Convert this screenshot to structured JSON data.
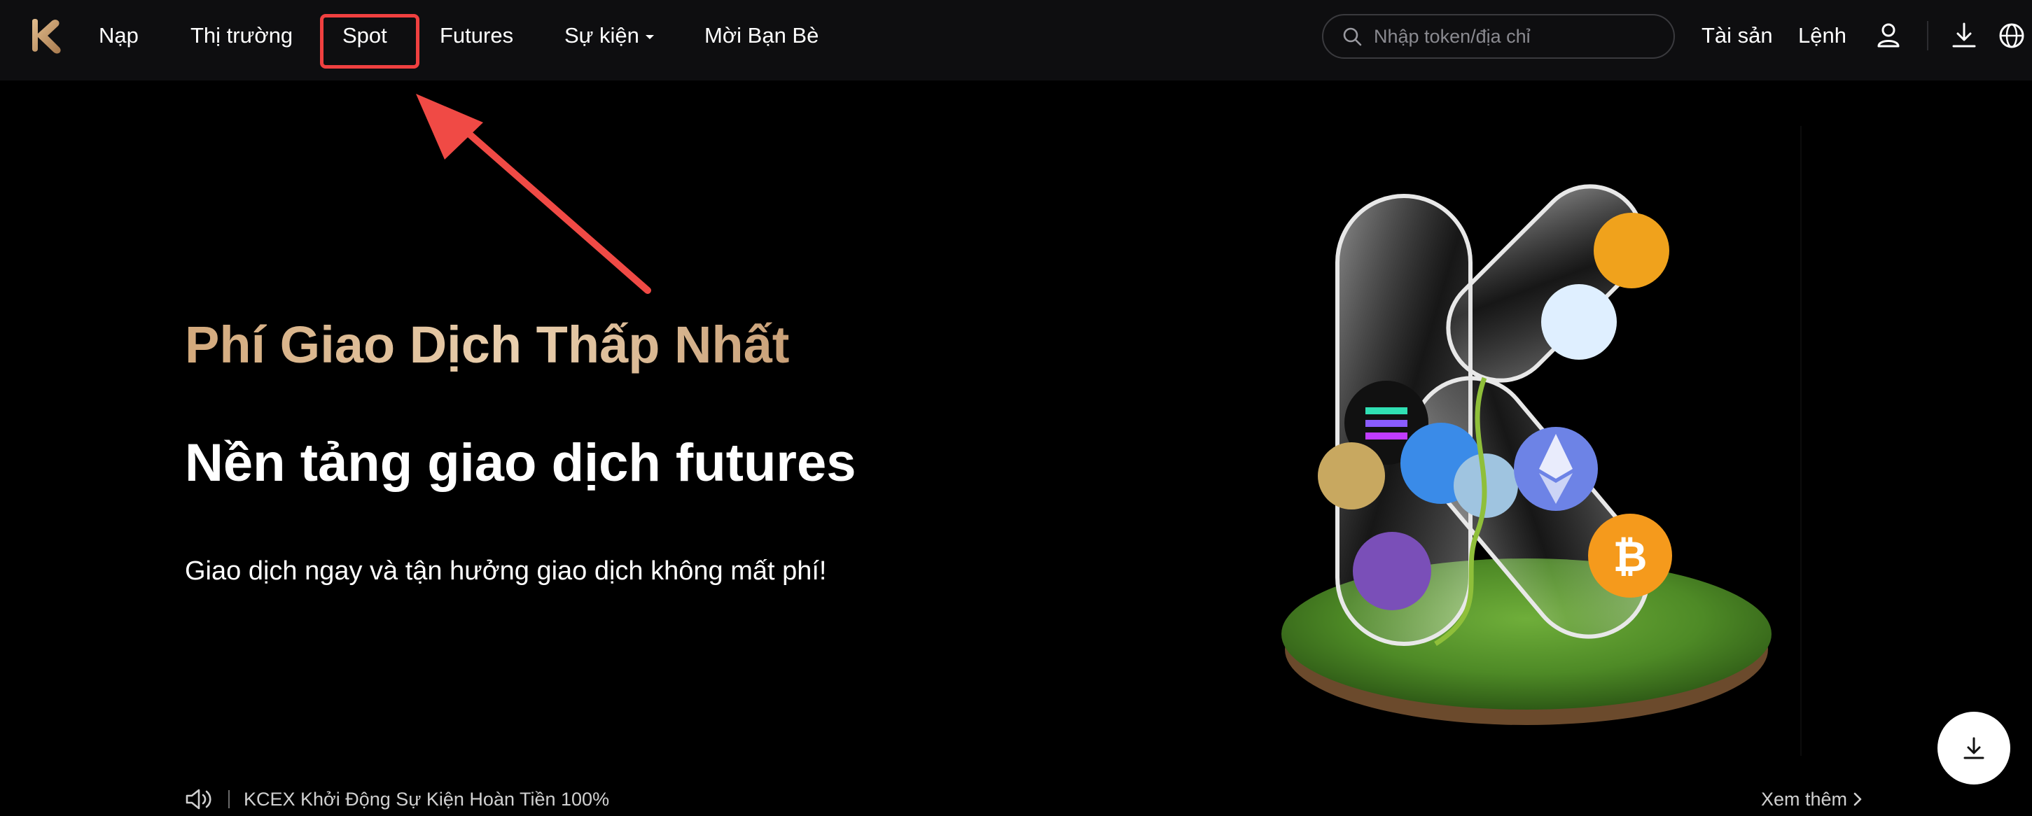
{
  "nav": {
    "items": [
      {
        "label": "Nạp"
      },
      {
        "label": "Thị trường"
      },
      {
        "label": "Spot"
      },
      {
        "label": "Futures"
      },
      {
        "label": "Sự kiện"
      },
      {
        "label": "Mời Bạn Bè"
      }
    ],
    "search_placeholder": "Nhập token/địa chỉ",
    "assets_label": "Tài sản",
    "orders_label": "Lệnh"
  },
  "hero": {
    "subtitle": "Phí Giao Dịch Thấp Nhất",
    "title": "Nền tảng giao dịch futures",
    "description": "Giao dịch ngay và tận hưởng giao dịch không mất phí!"
  },
  "announcement": {
    "text": "KCEX Khởi Động Sự Kiện Hoàn Tiền 100%",
    "see_more": "Xem thêm"
  },
  "icons": {
    "logo": "kcex-logo-icon",
    "search": "search-icon",
    "user": "user-icon",
    "download": "download-icon",
    "language": "globe-icon",
    "speaker": "speaker-icon",
    "chevron": "chevron-right-icon"
  },
  "colors": {
    "background": "#000000",
    "nav_background": "#0e0e10",
    "accent_gold": "#d3a97c",
    "highlight_red": "#f04040"
  }
}
